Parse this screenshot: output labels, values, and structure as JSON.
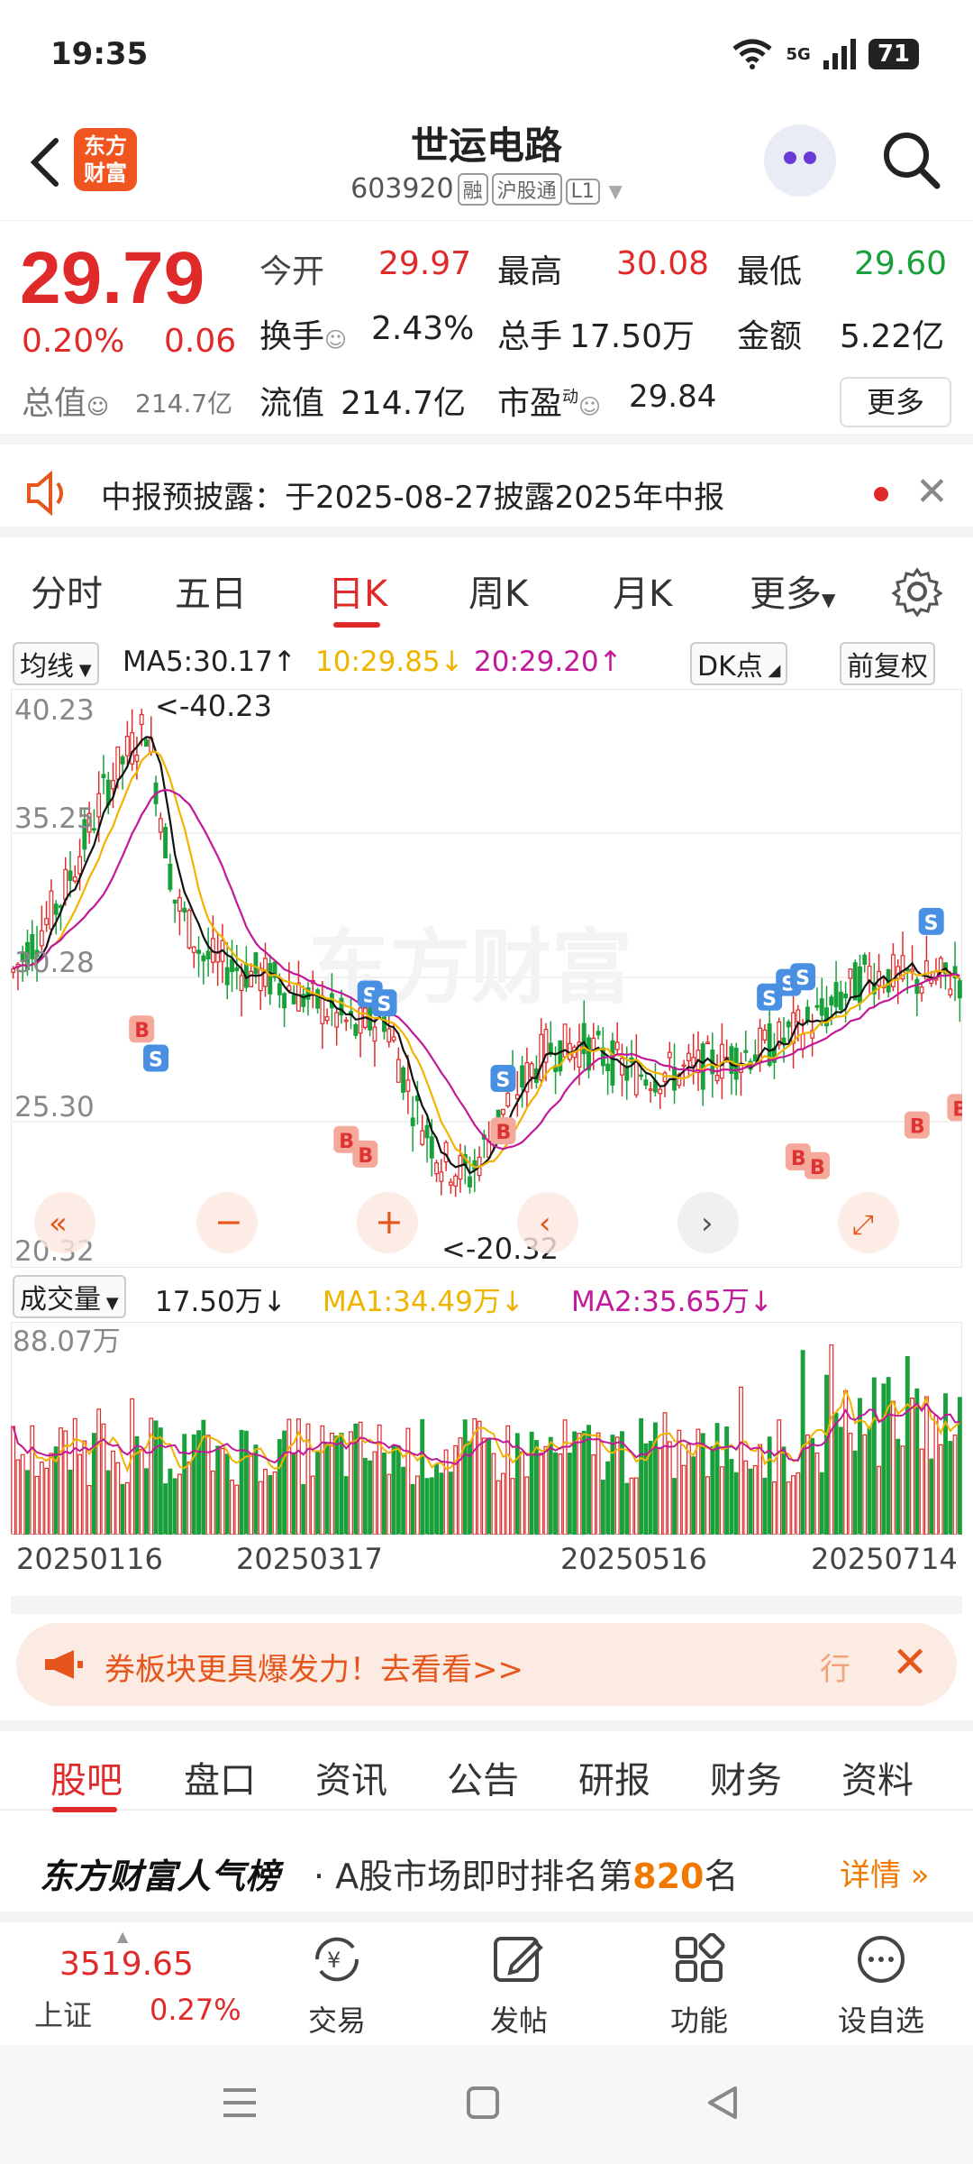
{
  "status": {
    "time": "19:35",
    "network": "5G",
    "battery": "71"
  },
  "header": {
    "stock_name": "世运电路",
    "code": "603920",
    "tag_margin": "融",
    "tag_connect": "沪股通",
    "tag_level": "L1",
    "logo_line1": "东方",
    "logo_line2": "财富"
  },
  "quote": {
    "price": "29.79",
    "pct": "0.20%",
    "chg": "0.06",
    "open_label": "今开",
    "open": "29.97",
    "high_label": "最高",
    "high": "30.08",
    "low_label": "最低",
    "low": "29.60",
    "turnover_label": "换手",
    "turnover": "2.43%",
    "volume_label": "总手",
    "volume": "17.50万",
    "amount_label": "金额",
    "amount": "5.22亿",
    "mktcap_label": "总值",
    "mktcap": "214.7亿",
    "float_label": "流值",
    "float": "214.7亿",
    "pe_label": "市盈",
    "pe_sup": "动",
    "pe": "29.84",
    "more": "更多"
  },
  "notice": {
    "text": "中报预披露：于2025-08-27披露2025年中报"
  },
  "ktabs": {
    "t1": "分时",
    "t2": "五日",
    "t3": "日K",
    "t4": "周K",
    "t5": "月K",
    "t6": "更多"
  },
  "ma": {
    "selector": "均线",
    "ma5": "MA5:30.17",
    "ma10": "10:29.85",
    "ma20": "20:29.20",
    "dk": "DK点",
    "adjust": "前复权"
  },
  "kchart": {
    "y_top": "40.23",
    "y2": "35.25",
    "y3": "30.28",
    "y4": "25.30",
    "y_bottom": "20.32",
    "max_label": "<-40.23",
    "min_label": "<-20.32",
    "watermark": "东方财富"
  },
  "vol": {
    "selector": "成交量",
    "vol": "17.50万",
    "ma1": "MA1:34.49万",
    "ma2": "MA2:35.65万",
    "max": "88.07万"
  },
  "dates": {
    "d1": "20250116",
    "d2": "20250317",
    "d3": "20250516",
    "d4": "20250714"
  },
  "banner": {
    "text": "券板块更具爆发力！去看看>>",
    "right": "行"
  },
  "btabs": {
    "t1": "股吧",
    "t2": "盘口",
    "t3": "资讯",
    "t4": "公告",
    "t5": "研报",
    "t6": "财务",
    "t7": "资料"
  },
  "rank": {
    "brand": "东方财富人气榜",
    "prefix": "· A股市场即时排名第",
    "num": "820",
    "suffix": "名",
    "detail": "详情"
  },
  "toolbar": {
    "index_val": "3519.65",
    "index_name": "上证",
    "index_pct": "0.27%",
    "trade": "交易",
    "post": "发帖",
    "func": "功能",
    "watch": "设自选"
  },
  "chart_data": {
    "type": "candlestick",
    "y_range": [
      20.32,
      40.23
    ],
    "x_ticks": [
      "20250116",
      "20250317",
      "20250516",
      "20250714"
    ],
    "ma5": 30.17,
    "ma10": 29.85,
    "ma20": 29.2,
    "high": 40.23,
    "low": 20.32,
    "volume_max": "88.07万"
  }
}
